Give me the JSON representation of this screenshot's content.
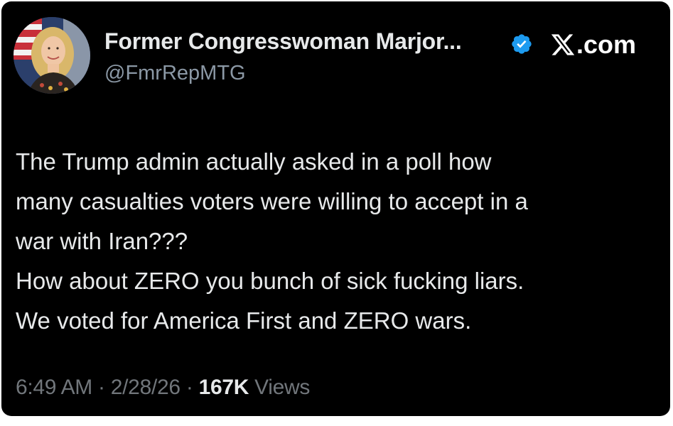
{
  "post": {
    "author": {
      "display_name": "Former Congresswoman Marjor...",
      "handle": "@FmrRepMTG",
      "verified": true,
      "verified_color": "#1d9bf0",
      "avatar_icon": "profile-photo"
    },
    "brand": {
      "logo_icon": "x-logo-icon",
      "domain": ".com"
    },
    "text_lines": [
      "The Trump admin actually asked in a poll how",
      "many casualties voters were willing to accept in a",
      "war with Iran???",
      "How about ZERO you bunch of sick fucking liars.",
      "We voted for America First and ZERO wars."
    ],
    "meta": {
      "time": "6:49 AM",
      "separator": "·",
      "date": "2/28/26",
      "views_count": "167K",
      "views_label": "Views"
    }
  },
  "colors": {
    "background": "#000000",
    "text_primary": "#e7e9ea",
    "text_secondary": "#71767b",
    "handle": "#8b98a5"
  }
}
